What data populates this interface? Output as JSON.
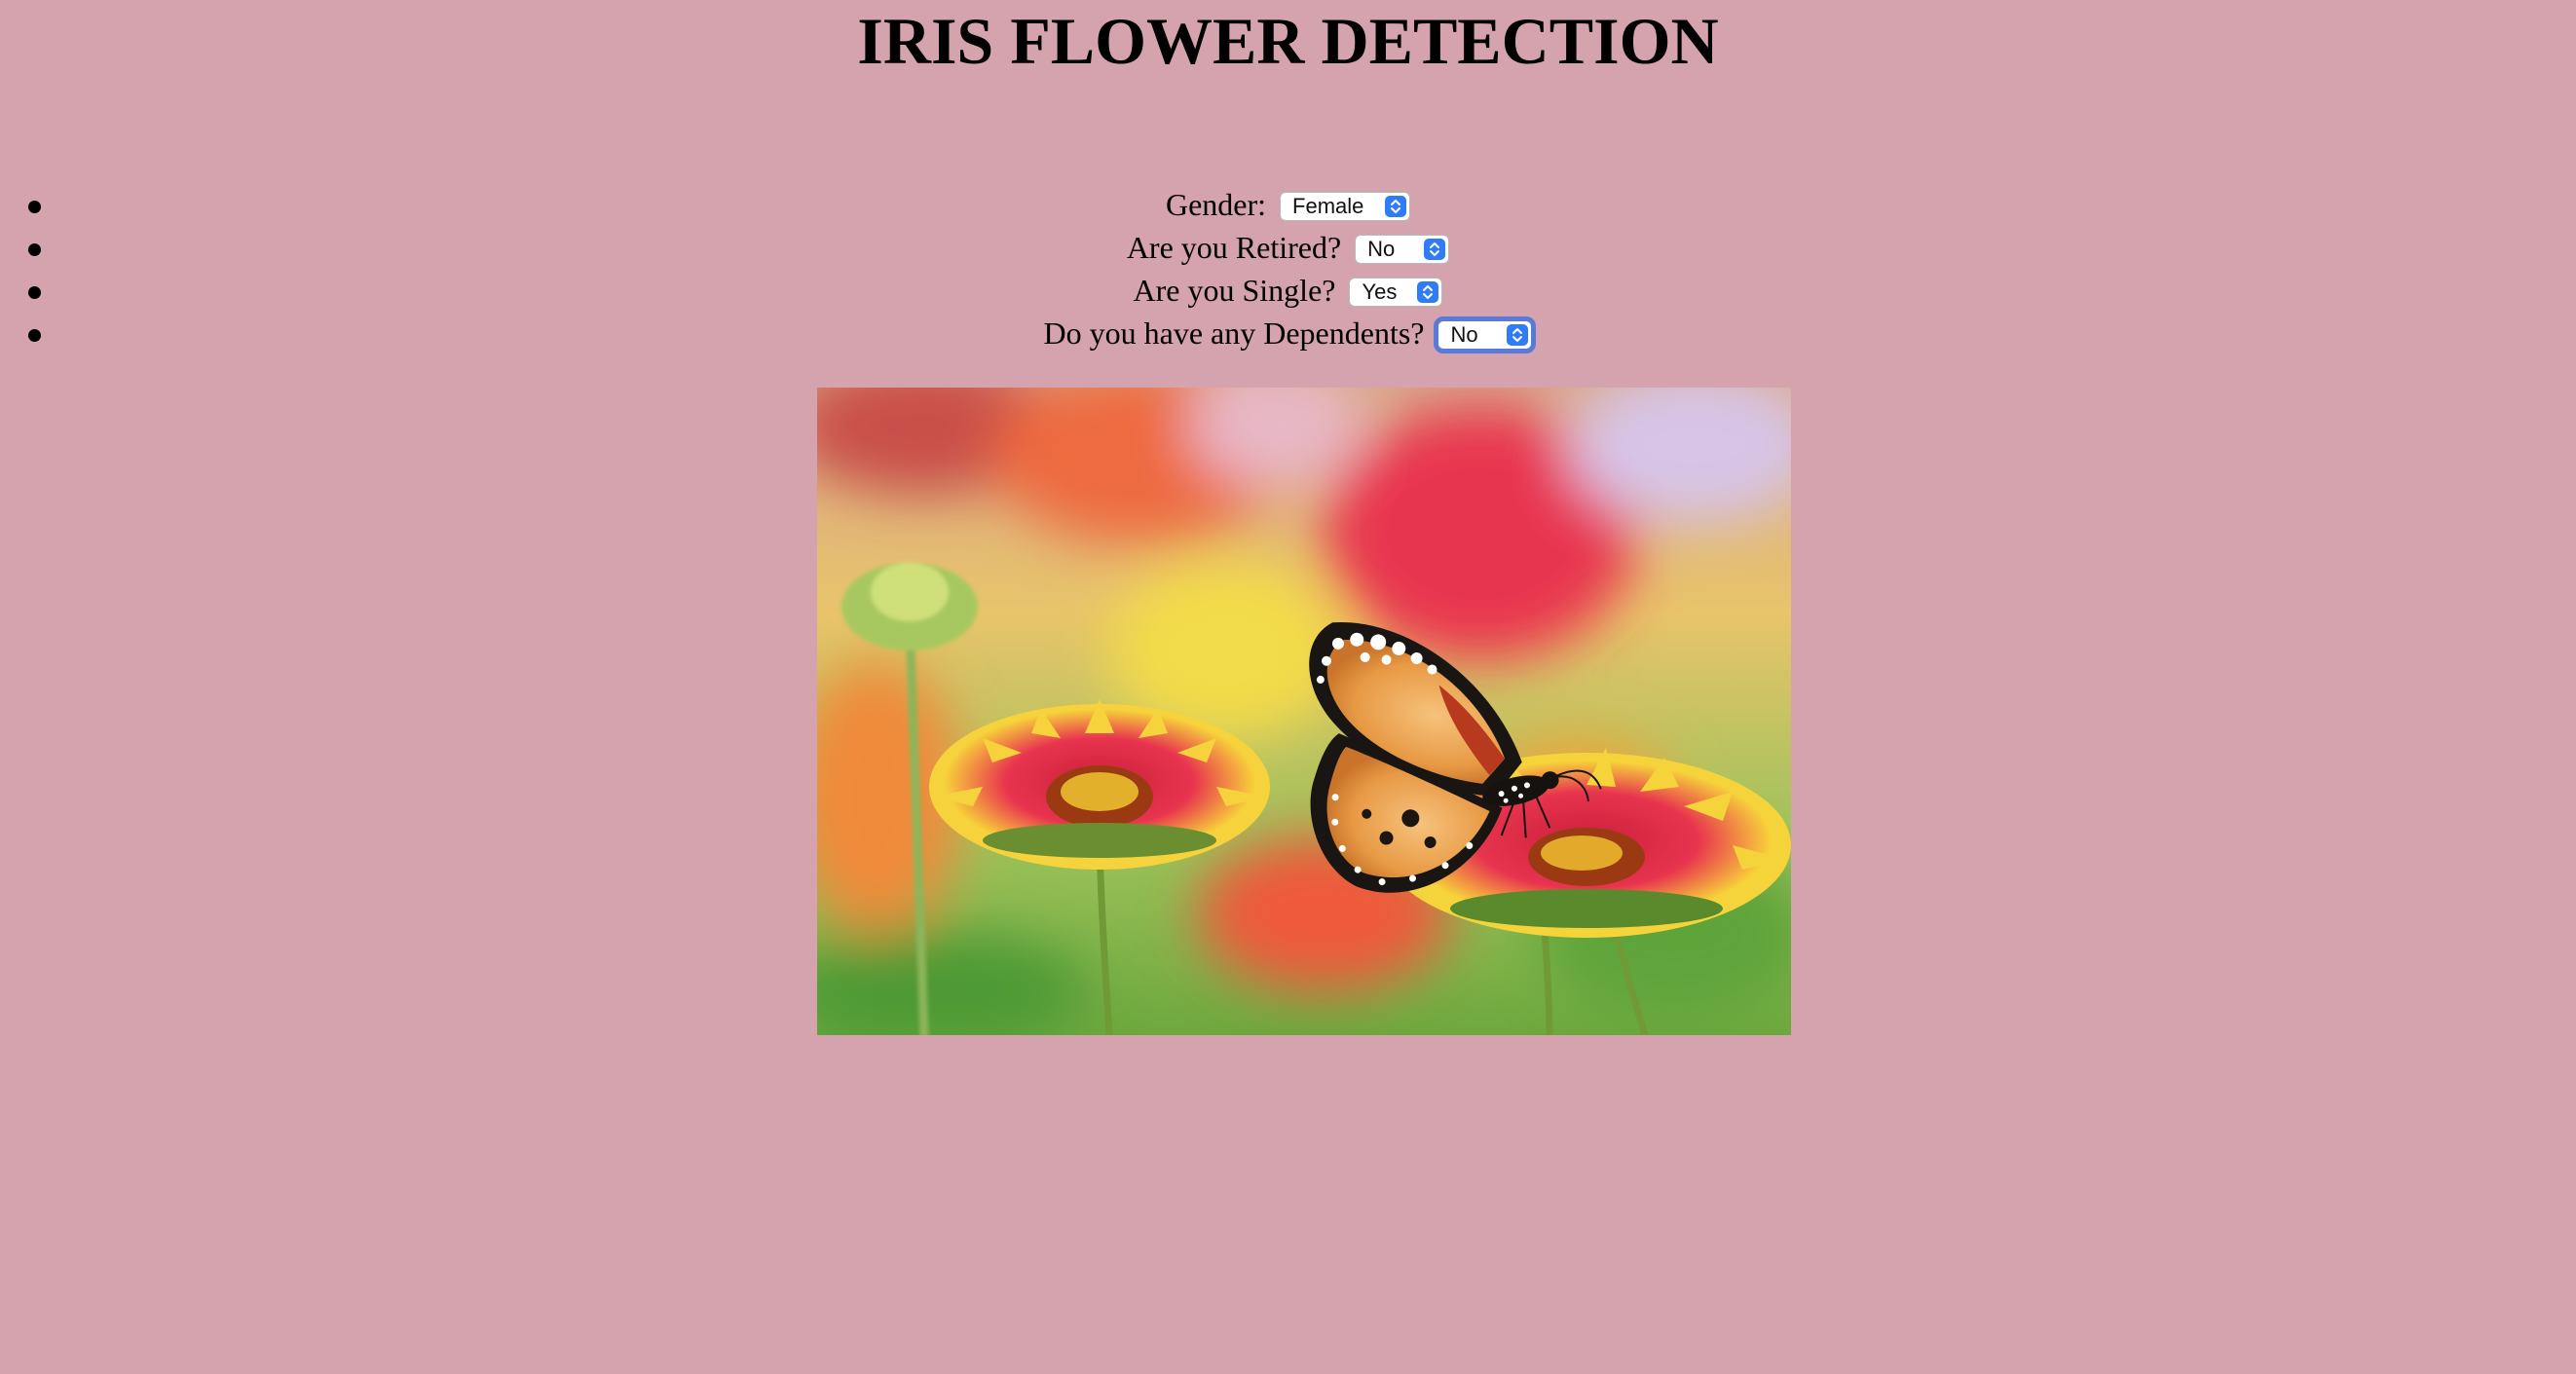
{
  "page": {
    "title": "IRIS FLOWER DETECTION",
    "background_color": "#d4a3ad",
    "accent_color": "#2f7cf6"
  },
  "form": {
    "questions": [
      {
        "label": "Gender:",
        "selected": "Female",
        "focused": false
      },
      {
        "label": "Are you Retired?",
        "selected": "No",
        "focused": false
      },
      {
        "label": "Are you Single?",
        "selected": "Yes",
        "focused": false
      },
      {
        "label": "Do you have any Dependents?",
        "selected": "No",
        "focused": true
      }
    ]
  },
  "image": {
    "subject": "butterfly-on-flowers-photo"
  }
}
